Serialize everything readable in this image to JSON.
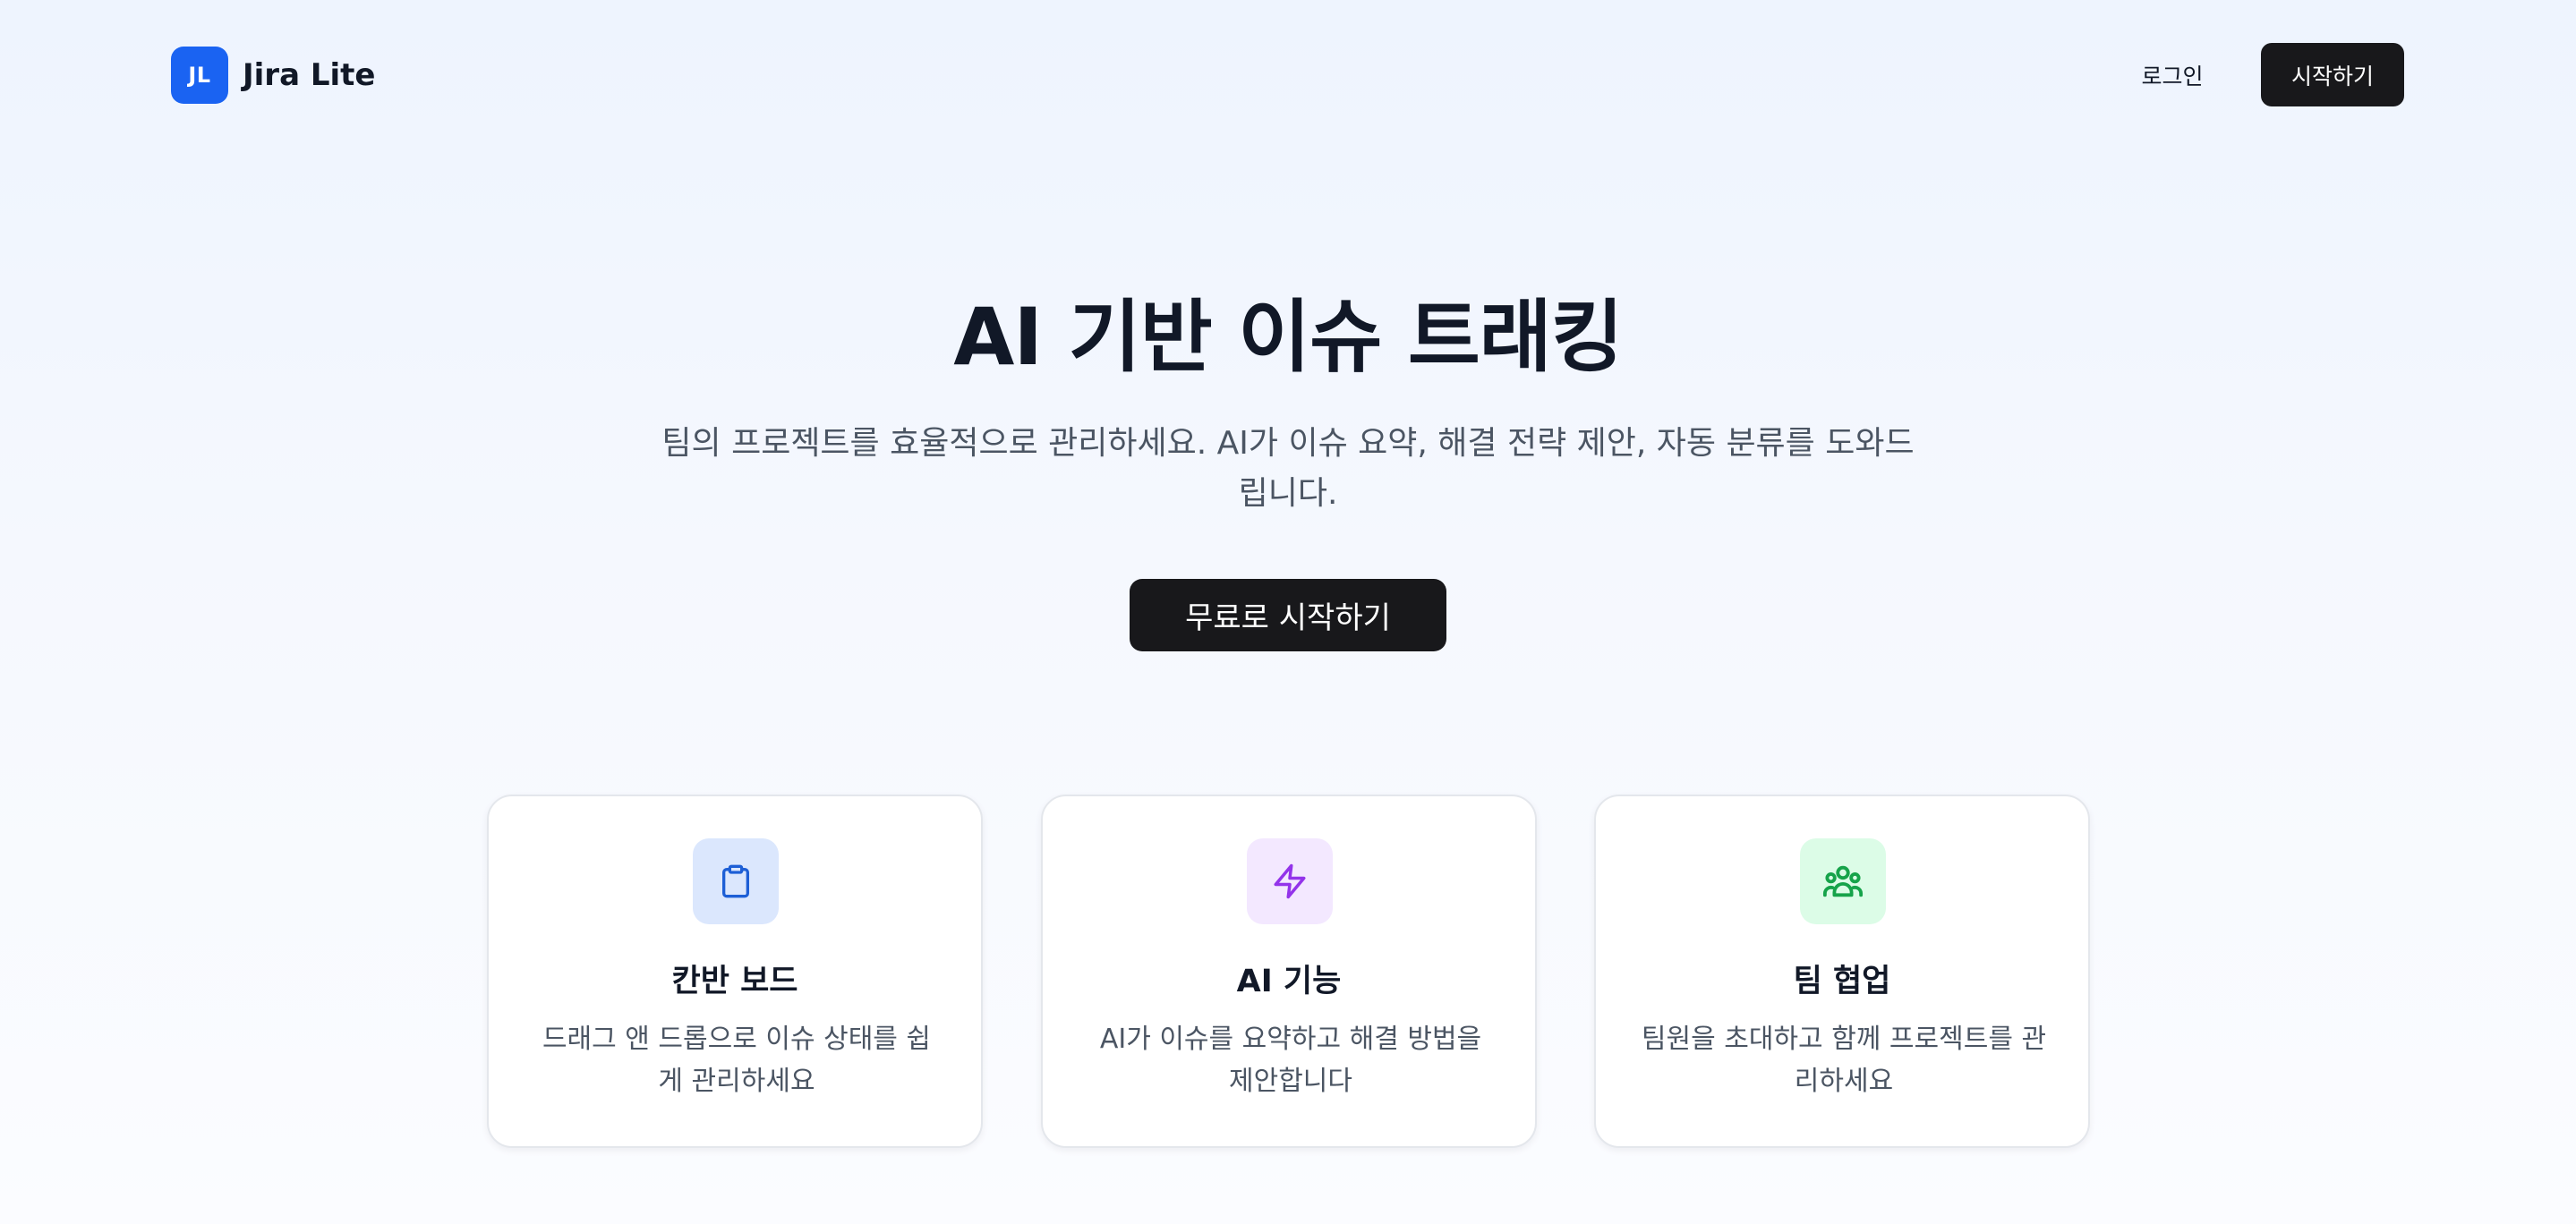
{
  "header": {
    "logo_mark": "JL",
    "logo_text": "Jira Lite",
    "login_label": "로그인",
    "start_label": "시작하기"
  },
  "hero": {
    "title": "AI 기반 이슈 트래킹",
    "subtitle": "팀의 프로젝트를 효율적으로 관리하세요. AI가 이슈 요약, 해결 전략 제안, 자동 분류를 도와드립니다.",
    "cta_label": "무료로 시작하기"
  },
  "features": [
    {
      "icon": "clipboard-icon",
      "title": "칸반 보드",
      "description": "드래그 앤 드롭으로 이슈 상태를 쉽게 관리하세요"
    },
    {
      "icon": "lightning-bolt-icon",
      "title": "AI 기능",
      "description": "AI가 이슈를 요약하고 해결 방법을 제안합니다"
    },
    {
      "icon": "team-users-icon",
      "title": "팀 협업",
      "description": "팀원을 초대하고 함께 프로젝트를 관리하세요"
    }
  ],
  "colors": {
    "brand_blue": "#1a63f2",
    "dark_button": "#18181b",
    "icon_blue": "#1d5fd6",
    "icon_blue_bg": "#dbe7fd",
    "icon_purple": "#9333ea",
    "icon_purple_bg": "#f3e8ff",
    "icon_green": "#16a34a",
    "icon_green_bg": "#dcfce7"
  }
}
